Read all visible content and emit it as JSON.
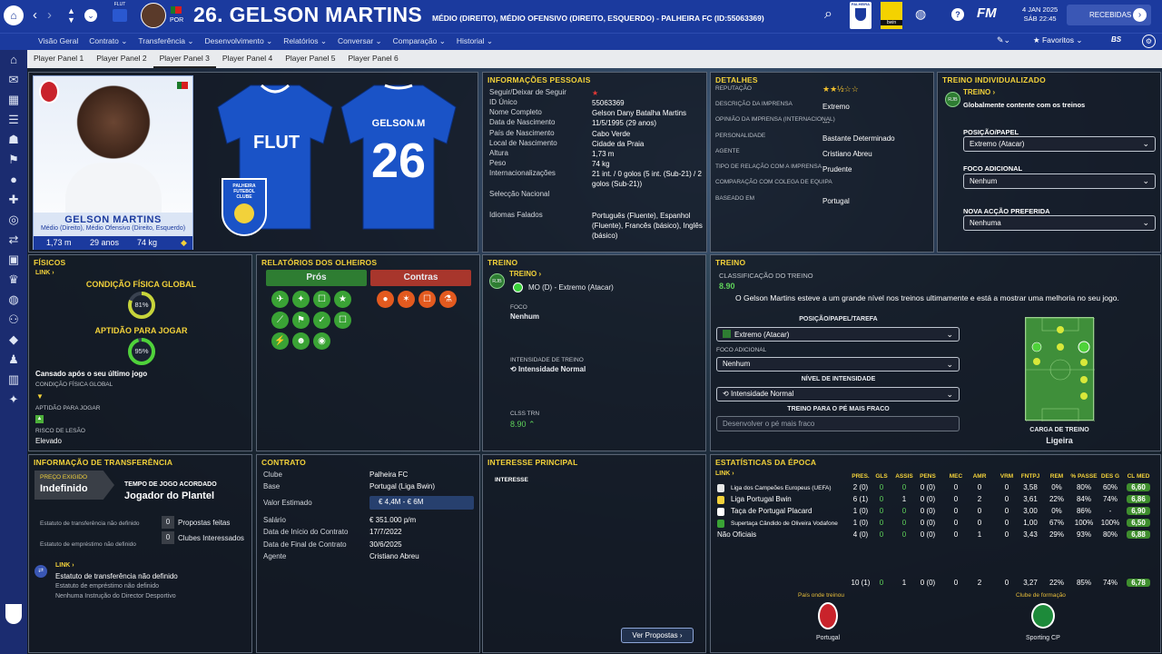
{
  "header": {
    "number_name": "26. GELSON MARTINS",
    "position_line": "MÉDIO (DIREITO), MÉDIO OFENSIVO (DIREITO, ESQUERDO) - PALHEIRA FC (ID:55063369)",
    "nation": "POR",
    "kit_brand": "FLUT",
    "date": "4 JAN 2025",
    "time": "SÁB 22:45",
    "inbox": "RECEBIDAS",
    "club_name": "PALHEIRA",
    "sponsor": "bwin"
  },
  "nav": [
    "Visão Geral",
    "Contrato",
    "Transferência",
    "Desenvolvimento",
    "Relatórios",
    "Conversar",
    "Comparação",
    "Historial"
  ],
  "favorites": "Favoritos",
  "subtabs": [
    "Player Panel 1",
    "Player Panel 2",
    "Player Panel 3",
    "Player Panel 4",
    "Player Panel 5",
    "Player Panel 6"
  ],
  "card": {
    "name": "GELSON MARTINS",
    "positions": "Médio (Direito), Médio Ofensivo (Direito, Esquerdo)",
    "height": "1,73 m",
    "age": "29 anos",
    "weight": "74 kg"
  },
  "kit": {
    "front": "FLUT",
    "back_name": "GELSON.M",
    "back_number": "26",
    "crest": "PALHEIRA FUTEBOL CLUBE"
  },
  "personal": {
    "title": "INFORMAÇÕES PESSOAIS",
    "rows": [
      {
        "label": "Seguir/Deixar de Seguir",
        "value": "★"
      },
      {
        "label": "ID Único",
        "value": "55063369"
      },
      {
        "label": "Nome Completo",
        "value": "Gelson Dany Batalha Martins"
      },
      {
        "label": "Data de Nascimento",
        "value": "11/5/1995 (29 anos)"
      },
      {
        "label": "País de Nascimento",
        "value": "Cabo Verde"
      },
      {
        "label": "Local de Nascimento",
        "value": "Cidade da Praia"
      },
      {
        "label": "Altura",
        "value": "1,73 m"
      },
      {
        "label": "Peso",
        "value": "74 kg"
      },
      {
        "label": "Internacionalizações",
        "value": "21 int. / 0 golos (5 int. (Sub-21) / 2 golos (Sub-21))"
      },
      {
        "label": "Selecção Nacional",
        "value": ""
      },
      {
        "label": "Idiomas Falados",
        "value": "Português (Fluente), Espanhol (Fluente), Francês (básico), Inglês (básico)"
      }
    ]
  },
  "details": {
    "title": "DETALHES",
    "rows": [
      {
        "label": "REPUTAÇÃO",
        "value": "★★½☆☆"
      },
      {
        "label": "DESCRIÇÃO DA IMPRENSA",
        "value": "Extremo"
      },
      {
        "label": "OPINIÃO DA IMPRENSA (INTERNACIONAL)",
        "value": "---"
      },
      {
        "label": "PERSONALIDADE",
        "value": "Bastante Determinado"
      },
      {
        "label": "AGENTE",
        "value": "Cristiano Abreu"
      },
      {
        "label": "TIPO DE RELAÇÃO COM A IMPRENSA",
        "value": "Prudente"
      },
      {
        "label": "COMPARAÇÃO COM COLEGA DE EQUIPA",
        "value": ""
      },
      {
        "label": "BASEADO EM",
        "value": "Portugal"
      }
    ]
  },
  "indiv": {
    "title": "TREINO INDIVIDUALIZADO",
    "role": "RJB",
    "link": "TREINO",
    "status": "Globalmente contente com os treinos",
    "pos_label": "POSIÇÃO/PAPEL",
    "pos_value": "Extremo (Atacar)",
    "focus_label": "FOCO ADICIONAL",
    "focus_value": "Nenhum",
    "action_label": "NOVA ACÇÃO PREFERIDA",
    "action_value": "Nenhuma"
  },
  "fisicos": {
    "title": "FÍSICOS",
    "link": "LINK",
    "cond_label": "CONDIÇÃO FÍSICA GLOBAL",
    "cond_pct": "81%",
    "cond_val": 81,
    "apt_label": "APTIDÃO PARA JOGAR",
    "apt_pct": "95%",
    "apt_val": 95,
    "tired": "Cansado após o seu último jogo",
    "s1": "CONDIÇÃO FÍSICA GLOBAL",
    "s2": "APTIDÃO PARA JOGAR",
    "s3": "RISCO DE LESÃO",
    "risk": "Elevado"
  },
  "scouts": {
    "title": "RELATÓRIOS DOS OLHEIROS",
    "pros": "Prós",
    "cons": "Contras"
  },
  "treino_small": {
    "title": "TREINO",
    "role": "RJB",
    "link": "TREINO",
    "pos": "MO (D) - Extremo (Atacar)",
    "focus_label": "FOCO",
    "focus": "Nenhum",
    "int_label": "INTENSIDADE DE TREINO",
    "int": "Intensidade Normal",
    "clss_label": "CLSS TRN",
    "clss": "8.90"
  },
  "treino": {
    "title": "TREINO",
    "class_label": "CLASSIFICAÇÃO DO TREINO",
    "class_val": "8.90",
    "desc": "O Gelson Martins esteve a um grande nível nos treinos ultimamente e está a mostrar uma melhoria no seu jogo.",
    "l1": "POSIÇÃO/PAPEL/TAREFA",
    "v1": "Extremo (Atacar)",
    "l2": "FOCO ADICIONAL",
    "v2": "Nenhum",
    "l3": "NÍVEL DE INTENSIDADE",
    "v3": "Intensidade Normal",
    "l4": "TREINO PARA O PÉ MAIS FRACO",
    "v4": "Desenvolver o pé mais fraco",
    "load_label": "CARGA DE TREINO",
    "load": "Ligeira"
  },
  "transfer": {
    "title": "INFORMAÇÃO DE TRANSFERÊNCIA",
    "price_label": "PREÇO EXIGIDO",
    "price": "Indefinido",
    "time_label": "TEMPO DE JOGO ACORDADO",
    "time": "Jogador do Plantel",
    "st1": "Estatuto de transferência não definido",
    "st2": "Estatuto de empréstimo não definido",
    "c1": "0",
    "c1l": "Propostas feitas",
    "c2": "0",
    "c2l": "Clubes Interessados",
    "link": "LINK",
    "n1": "Estatuto de transferência não definido",
    "n2": "Estatuto de empréstimo não definido",
    "n3": "Nenhuma Instrução do Director Desportivo"
  },
  "contract": {
    "title": "CONTRATO",
    "rows": [
      {
        "label": "Clube",
        "value": "Palheira FC"
      },
      {
        "label": "Base",
        "value": "Portugal (Liga Bwin)"
      },
      {
        "label": "Valor Estimado",
        "value": "€ 4,4M - € 6M"
      },
      {
        "label": "Salário",
        "value": "€ 351.000 p/m"
      },
      {
        "label": "Data de Início do Contrato",
        "value": "17/7/2022"
      },
      {
        "label": "Data de Final de Contrato",
        "value": "30/6/2025"
      },
      {
        "label": "Agente",
        "value": "Cristiano Abreu"
      }
    ]
  },
  "interest": {
    "title": "INTERESSE PRINCIPAL",
    "sub": "INTERESSE",
    "button": "Ver Propostas"
  },
  "stats": {
    "title": "ESTATÍSTICAS DA ÉPOCA",
    "link": "LINK",
    "headers": [
      "PRES.",
      "GLS",
      "ASSIS",
      "PENS",
      "MEC",
      "AMR",
      "VRM",
      "FNTPJ",
      "REM",
      "% PASSE",
      "DES G",
      "CL MED"
    ],
    "rows": [
      {
        "comp": "Liga dos Campeões Europeus (UEFA)",
        "v": [
          "2 (0)",
          "0",
          "0",
          "0 (0)",
          "0",
          "0",
          "0",
          "3,58",
          "0%",
          "80%",
          "60%",
          "6,60"
        ]
      },
      {
        "comp": "Liga Portugal Bwin",
        "v": [
          "6 (1)",
          "0",
          "1",
          "0 (0)",
          "0",
          "2",
          "0",
          "3,61",
          "22%",
          "84%",
          "74%",
          "6,86"
        ]
      },
      {
        "comp": "Taça de Portugal Placard",
        "v": [
          "1 (0)",
          "0",
          "0",
          "0 (0)",
          "0",
          "0",
          "0",
          "3,00",
          "0%",
          "86%",
          "-",
          "6,90"
        ]
      },
      {
        "comp": "Supertaça Cândido de Oliveira Vodafone",
        "v": [
          "1 (0)",
          "0",
          "0",
          "0 (0)",
          "0",
          "0",
          "0",
          "1,00",
          "67%",
          "100%",
          "100%",
          "6,50"
        ]
      },
      {
        "comp": "Não Oficiais",
        "v": [
          "4 (0)",
          "0",
          "0",
          "0 (0)",
          "0",
          "1",
          "0",
          "3,43",
          "29%",
          "93%",
          "80%",
          "6,88"
        ]
      }
    ],
    "total": [
      "10 (1)",
      "0",
      "1",
      "0 (0)",
      "0",
      "2",
      "0",
      "3,27",
      "22%",
      "85%",
      "74%",
      "6,78"
    ],
    "trained_label": "País onde treinou",
    "trained": "Portugal",
    "formed_label": "Clube de formação",
    "formed": "Sporting CP"
  }
}
